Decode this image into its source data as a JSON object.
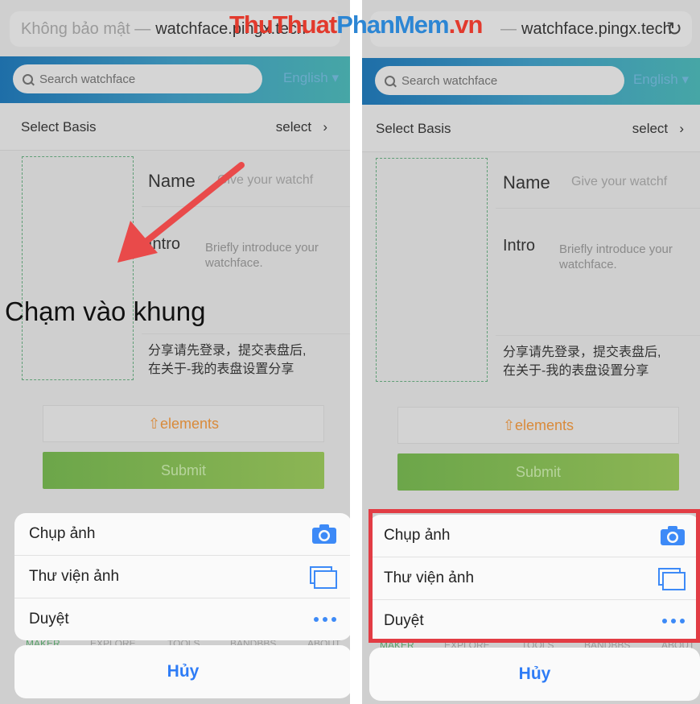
{
  "browser": {
    "left_prefix": "Không bảo mật —",
    "left_host": "watchface.pingx.tech",
    "right_prefix": "—",
    "right_host": "watchface.pingx.tech"
  },
  "header": {
    "search_placeholder": "Search watchface",
    "language": "English"
  },
  "basis": {
    "label": "Select Basis",
    "action": "select",
    "chevron": "›"
  },
  "form": {
    "name_label": "Name",
    "name_placeholder": "Give your watchf",
    "intro_label": "Intro",
    "intro_placeholder": "Briefly introduce your watchface.",
    "share_line1": "分享请先登录，提交表盘后,",
    "share_line2": "在关于-我的表盘设置分享",
    "elements_label": "⇧elements",
    "submit_label": "Submit"
  },
  "tabs": [
    "MAKER",
    "EXPLORE",
    "TOOLS",
    "BANDBBS",
    "ABOUT"
  ],
  "sheet": {
    "take_photo": "Chụp ảnh",
    "photo_library": "Thư viện ảnh",
    "browse": "Duyệt",
    "cancel": "Hủy"
  },
  "annotation": {
    "tap_frame_text": "Chạm vào khung"
  },
  "watermark": {
    "part1": "ThuThuat",
    "part2": "PhanMem",
    "part3": ".vn"
  },
  "icons": [
    "camera-icon",
    "gallery-icon",
    "more-dots-icon",
    "reload-icon",
    "search-icon"
  ],
  "colors": {
    "accent_blue": "#2e7cf6",
    "highlight_red": "#e23c44",
    "submit_green": "#6ca64a",
    "elements_orange": "#d98a3a",
    "arrow_red": "#e94a4a"
  }
}
